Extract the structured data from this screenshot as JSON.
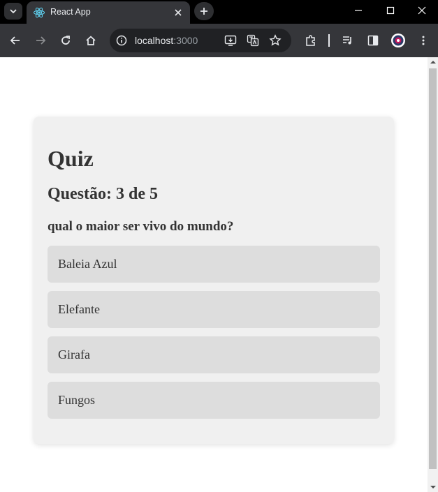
{
  "browser": {
    "tab_title": "React App",
    "url_host": "localhost",
    "url_port": ":3000"
  },
  "quiz": {
    "title": "Quiz",
    "progress": "Questão: 3 de 5",
    "question": "qual o maior ser vivo do mundo?",
    "options": [
      "Baleia Azul",
      "Elefante",
      "Girafa",
      "Fungos"
    ]
  },
  "colors": {
    "card_background": "#f0f0f0",
    "option_background": "#dddddd",
    "text": "#333333"
  }
}
